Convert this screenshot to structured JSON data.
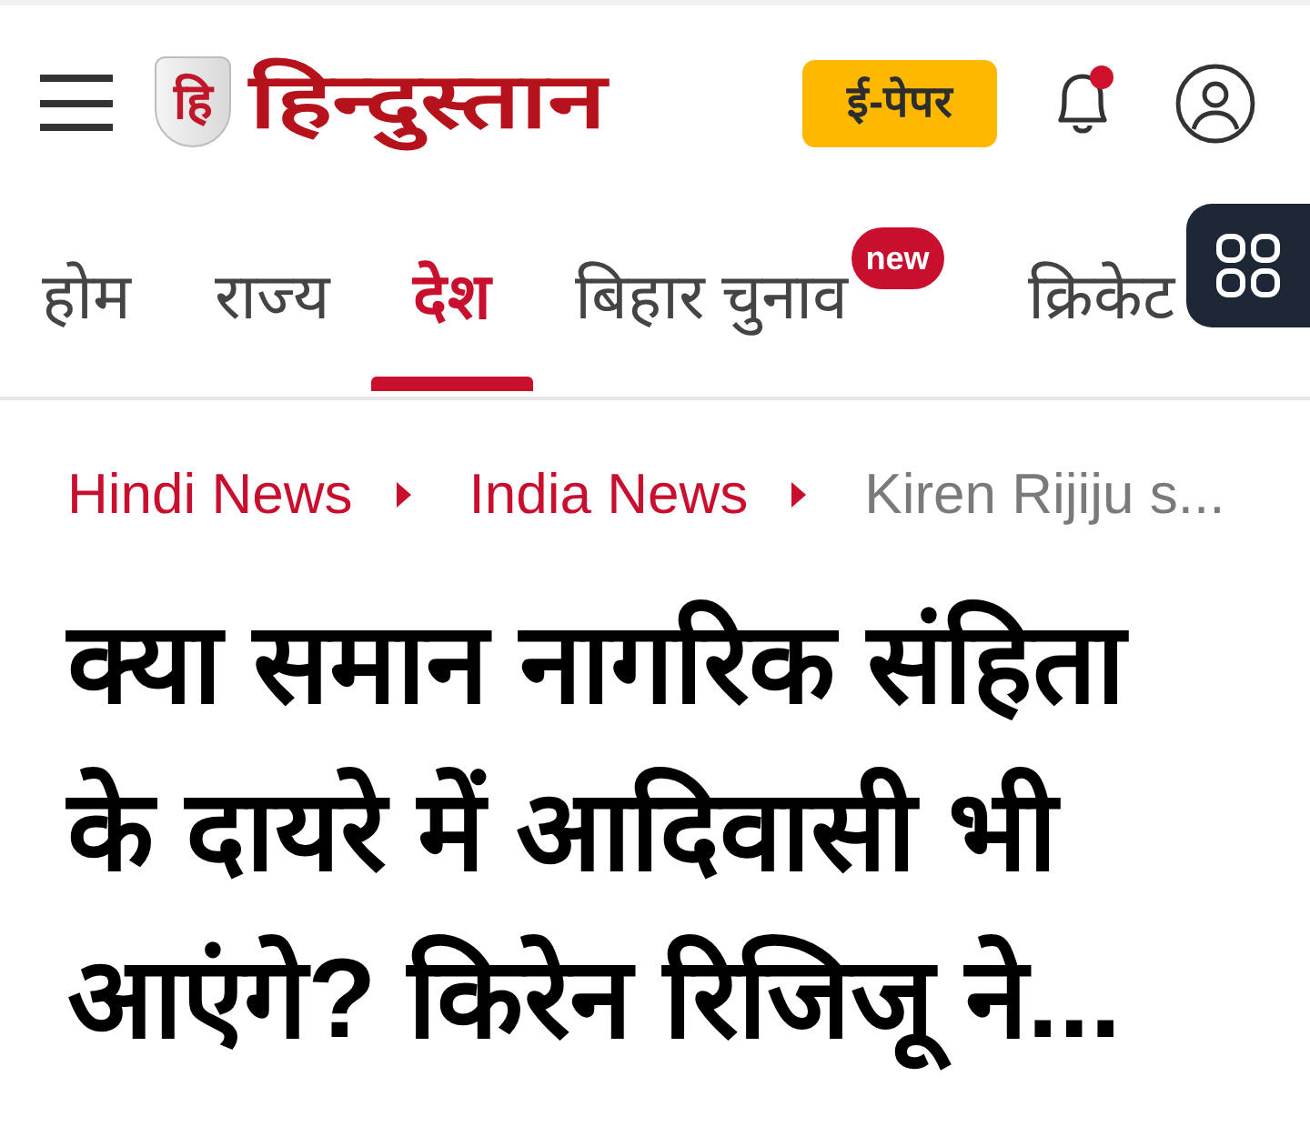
{
  "header": {
    "logo": {
      "mark": "हि",
      "wordmark": "हिन्दुस्तान"
    },
    "epaper_button": "ई-पेपर",
    "notifications": {
      "unread": true
    }
  },
  "nav_tabs": [
    {
      "label": "होम",
      "selected": false
    },
    {
      "label": "राज्य",
      "selected": false
    },
    {
      "label": "देश",
      "selected": true
    },
    {
      "label": "बिहार चुनाव",
      "selected": false,
      "badge": "new"
    },
    {
      "label": "क्रिकेट",
      "selected": false
    }
  ],
  "breadcrumbs": [
    {
      "label": "Hindi News",
      "kind": "link"
    },
    {
      "label": "India News",
      "kind": "link"
    },
    {
      "label": "Kiren Rijiju s...",
      "kind": "current"
    }
  ],
  "headline": "क्या समान नागरिक संहिता के दायरे में आदिवासी भी आएंगे? किरेन रिजिजू ने..."
}
